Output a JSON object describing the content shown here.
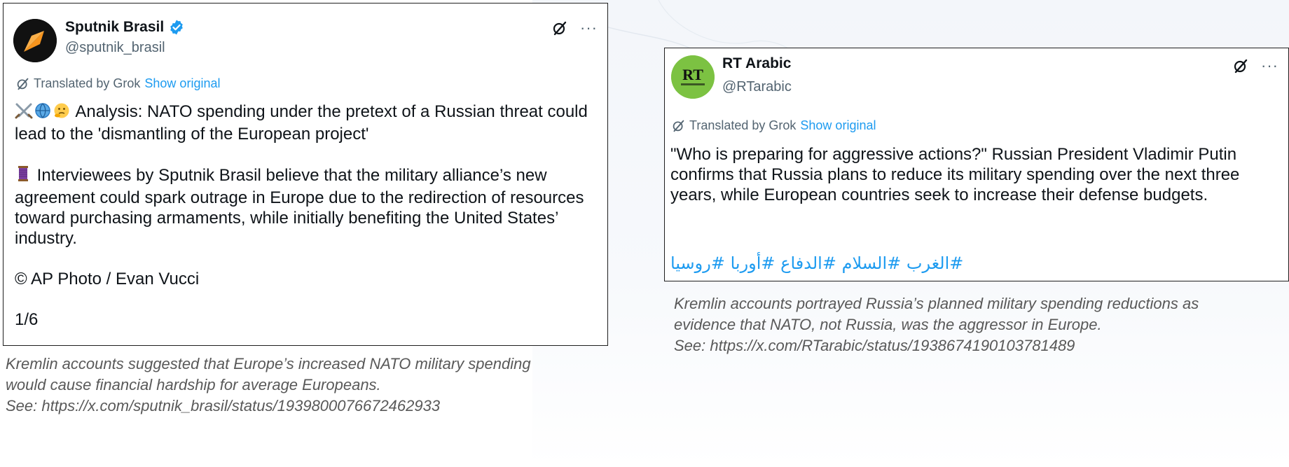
{
  "left_tweet": {
    "name": "Sputnik Brasil",
    "handle": "@sputnik_brasil",
    "translated_label": "Translated by Grok",
    "show_original": "Show original",
    "paragraph1": "Analysis: NATO spending under the pretext of a Russian threat could lead to the 'dismantling of the European project'",
    "paragraph2": "Interviewees by Sputnik Brasil believe that the military alliance’s new agreement could spark outrage in Europe due to the redirection of resources toward purchasing armaments, while initially benefiting the United States’ industry.",
    "credit": "© AP Photo / Evan Vucci",
    "counter": "1/6",
    "more": "···",
    "avatar_color": "#111111",
    "avatar_accent": "#f7941d"
  },
  "right_tweet": {
    "name": "RT Arabic",
    "handle": "@RTarabic",
    "translated_label": "Translated by Grok",
    "show_original": "Show original",
    "body": "\"Who is preparing for aggressive actions?\" Russian President Vladimir Putin confirms that Russia plans to reduce its military spending over the next three years, while European countries seek to increase their defense budgets.",
    "hashtags": "#الغرب #السلام #الدفاع #أوربا #روسيا",
    "more": "···",
    "avatar_color": "#7cc242",
    "avatar_text": "RT"
  },
  "captions": {
    "left": [
      "Kremlin accounts suggested that Europe’s increased NATO military spending",
      "would cause financial hardship for average Europeans.",
      "See: https://x.com/sputnik_brasil/status/1939800076672462933"
    ],
    "right": [
      "Kremlin accounts portrayed Russia’s planned military spending reductions as",
      "evidence that NATO, not Russia, was the aggressor in Europe.",
      "See: https://x.com/RTarabic/status/1938674190103781489"
    ]
  },
  "colors": {
    "link": "#1d9bf0",
    "secondary": "#536471",
    "verified": "#1d9bf0",
    "caption": "#595959"
  }
}
